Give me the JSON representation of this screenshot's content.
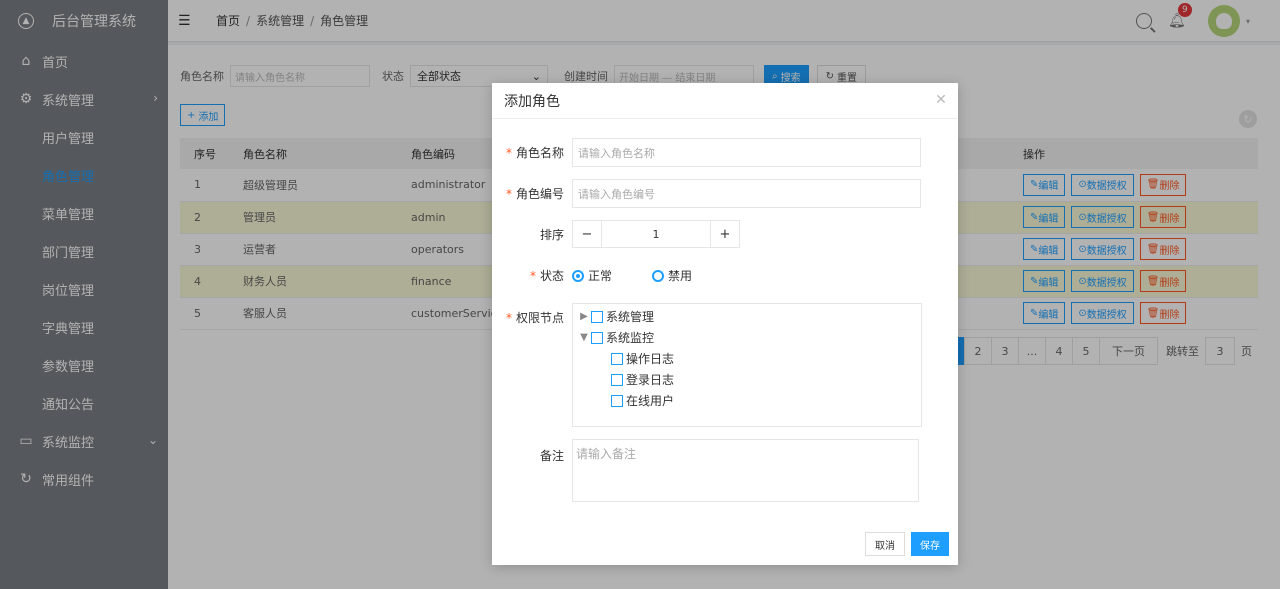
{
  "app": {
    "title": "后台管理系统"
  },
  "sidebar": {
    "items": [
      {
        "label": "首页",
        "icon": "home-icon"
      },
      {
        "label": "系统管理",
        "icon": "gear-icon"
      },
      {
        "label": "用户管理"
      },
      {
        "label": "角色管理"
      },
      {
        "label": "菜单管理"
      },
      {
        "label": "部门管理"
      },
      {
        "label": "岗位管理"
      },
      {
        "label": "字典管理"
      },
      {
        "label": "参数管理"
      },
      {
        "label": "通知公告"
      },
      {
        "label": "系统监控",
        "icon": "monitor-icon"
      },
      {
        "label": "常用组件",
        "icon": "refresh-icon"
      }
    ]
  },
  "header": {
    "breadcrumb": [
      "首页",
      "系统管理",
      "角色管理"
    ],
    "notification_count": "9"
  },
  "search": {
    "role_name_label": "角色名称",
    "role_name_placeholder": "请输入角色名称",
    "status_label": "状态",
    "status_value": "全部状态",
    "created_label": "创建时间",
    "date_placeholder": "开始日期 — 结束日期",
    "search_btn": "搜索",
    "reset_btn": "重置",
    "add_btn": "添加"
  },
  "table": {
    "headers": [
      "序号",
      "角色名称",
      "角色编码",
      "操作"
    ],
    "rows": [
      {
        "no": "1",
        "name": "超级管理员",
        "code": "administrator"
      },
      {
        "no": "2",
        "name": "管理员",
        "code": "admin"
      },
      {
        "no": "3",
        "name": "运营者",
        "code": "operators"
      },
      {
        "no": "4",
        "name": "财务人员",
        "code": "finance"
      },
      {
        "no": "5",
        "name": "客服人员",
        "code": "customerService"
      }
    ],
    "actions": {
      "edit": "编辑",
      "auth": "数据授权",
      "delete": "删除"
    }
  },
  "pager": {
    "pages": [
      "2",
      "3",
      "...",
      "4",
      "5"
    ],
    "next": "下一页",
    "goto_label": "跳转至",
    "goto_value": "3",
    "goto_tail": "页"
  },
  "modal": {
    "title": "添加角色",
    "role_name_label": "角色名称",
    "role_name_placeholder": "请输入角色名称",
    "role_code_label": "角色编号",
    "role_code_placeholder": "请输入角色编号",
    "sort_label": "排序",
    "sort_value": "1",
    "status_label": "状态",
    "status_normal": "正常",
    "status_disabled": "禁用",
    "perm_label": "权限节点",
    "tree": [
      {
        "label": "系统管理"
      },
      {
        "label": "系统监控"
      },
      {
        "label": "操作日志"
      },
      {
        "label": "登录日志"
      },
      {
        "label": "在线用户"
      }
    ],
    "remark_label": "备注",
    "remark_placeholder": "请输入备注",
    "cancel": "取消",
    "save": "保存"
  }
}
